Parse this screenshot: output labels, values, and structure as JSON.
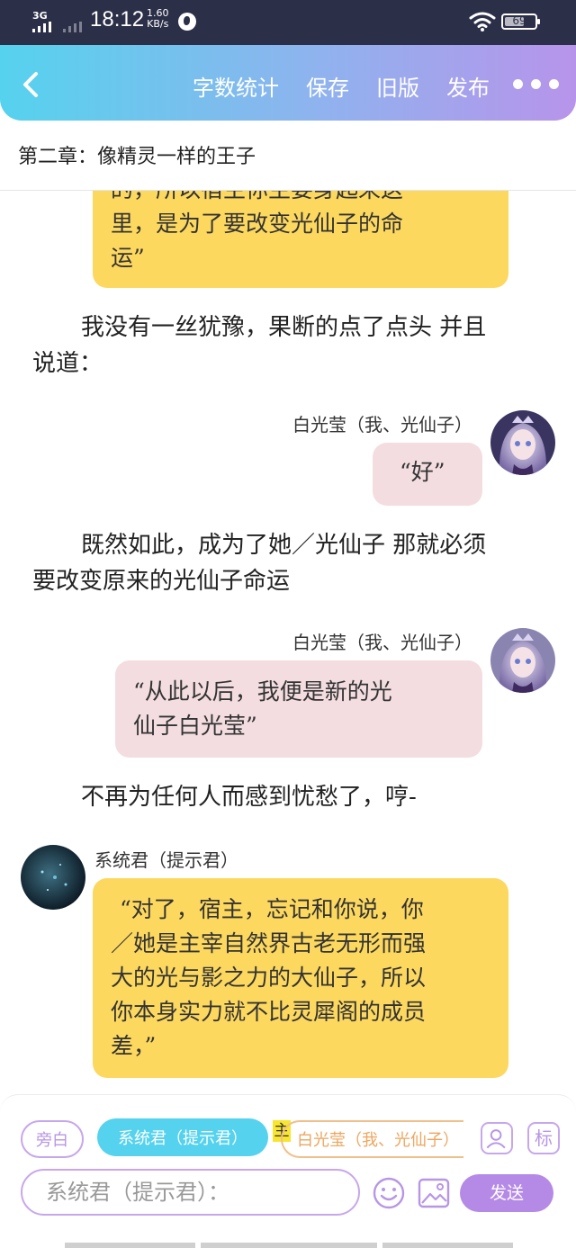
{
  "status_bar": {
    "network": "3G",
    "time": "18:12",
    "speed_value": "1.60",
    "speed_unit": "KB/s",
    "battery": "69",
    "battery_level": 0.69
  },
  "toolbar": {
    "back_icon": "chevron-left-icon",
    "word_count": "字数统计",
    "save": "保存",
    "old_version": "旧版",
    "publish": "发布",
    "more_icon": "more-dots-icon"
  },
  "chapter": {
    "title": "第二章：像精灵一样的王子"
  },
  "messages": [
    {
      "type": "system-bubble",
      "lines": [
        "的，所以宿主你主要身起来这",
        "里，是为了要改变光仙子的命",
        "运”"
      ]
    },
    {
      "type": "narration",
      "lines": [
        "我没有一丝犹豫，果断的点了点头 并且",
        "说道："
      ]
    },
    {
      "type": "self",
      "speaker": "白光莹（我、光仙子）",
      "lines": [
        "“好”"
      ]
    },
    {
      "type": "narration",
      "lines": [
        "既然如此，成为了她／光仙子 那就必须",
        "要改变原来的光仙子命运"
      ]
    },
    {
      "type": "self",
      "speaker": "白光莹（我、光仙子）",
      "lines": [
        "“从此以后，我便是新的光",
        "仙子白光莹”"
      ]
    },
    {
      "type": "narration",
      "lines": [
        "不再为任何人而感到忧愁了，哼-"
      ]
    },
    {
      "type": "system",
      "speaker": "系统君（提示君）",
      "lines": [
        "“对了，宿主，忘记和你说，你",
        "／她是主宰自然界古老无形而强",
        "大的光与影之力的大仙子，所以",
        "你本身实力就不比灵犀阁的成员",
        "差，”"
      ]
    }
  ],
  "editor": {
    "narrator_chip": "旁白",
    "system_chip": "系统君（提示君）",
    "main_tag": "主",
    "self_chip": "白光莹（我、光仙子）",
    "avatar_button_icon": "character-icon",
    "mark_button": "标",
    "input_placeholder": "系统君（提示君）：",
    "emoji_icon": "emoji-icon",
    "image_icon": "image-icon",
    "send": "发送"
  }
}
